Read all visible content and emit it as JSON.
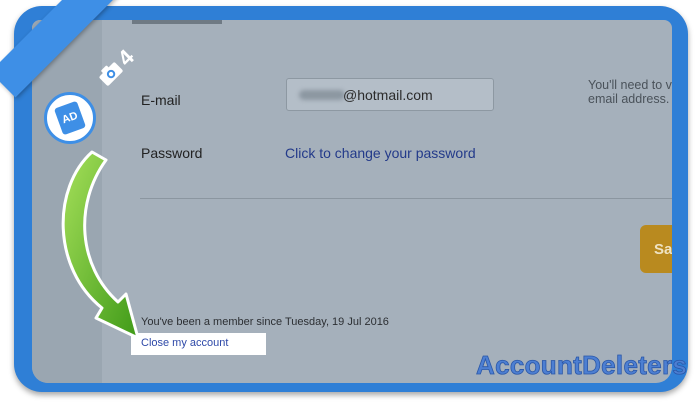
{
  "form": {
    "email_label": "E-mail",
    "email_value": "@hotmail.com",
    "password_label": "Password",
    "change_password_link": "Click to change your password",
    "hint_text": "You'll need to v\nemail address.",
    "save_label": "Sa"
  },
  "footer": {
    "member_since": "You've been a member since Tuesday, 19 Jul 2016",
    "close_account_link": "Close my account"
  },
  "overlay": {
    "step_number": "4",
    "badge_text": "AD",
    "brand_text": "AccountDeleters",
    "arrow_icon": "curved-green-arrow",
    "camera_icon": "camera-icon"
  },
  "colors": {
    "frame": "#2f7fd6",
    "background": "#a5b0bb",
    "save_button": "#b98a1f",
    "arrow": "#6cc12a"
  }
}
